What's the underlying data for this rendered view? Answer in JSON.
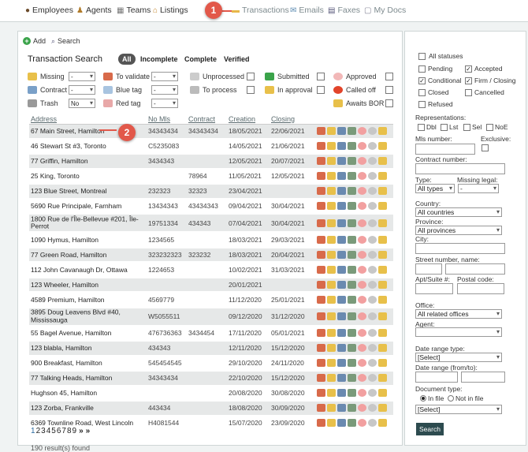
{
  "nav": {
    "items": [
      {
        "label": "Employees",
        "icon": "people-icon"
      },
      {
        "label": "Agents",
        "icon": "agent-icon"
      },
      {
        "label": "Teams",
        "icon": "teams-icon"
      },
      {
        "label": "Listings",
        "icon": "listings-icon"
      },
      {
        "label": "Transactions",
        "icon": "folder-icon"
      },
      {
        "label": "Emails",
        "icon": "email-icon"
      },
      {
        "label": "Faxes",
        "icon": "fax-icon"
      },
      {
        "label": "My Docs",
        "icon": "docs-icon"
      }
    ],
    "callout1": "1"
  },
  "toolbar": {
    "add_label": "Add",
    "search_label": "Search"
  },
  "main": {
    "title": "Transaction Search",
    "tabs": [
      "All",
      "Incomplete",
      "Complete",
      "Verified"
    ],
    "filters": {
      "missing": {
        "label": "Missing",
        "value": "-"
      },
      "to_validate": {
        "label": "To validate",
        "value": "-"
      },
      "unprocessed": {
        "label": "Unprocessed"
      },
      "submitted": {
        "label": "Submitted"
      },
      "approved": {
        "label": "Approved"
      },
      "contract": {
        "label": "Contract",
        "value": "-"
      },
      "blue_tag": {
        "label": "Blue tag",
        "value": "-"
      },
      "to_process": {
        "label": "To process"
      },
      "in_approval": {
        "label": "In approval"
      },
      "called_off": {
        "label": "Called off"
      },
      "trash": {
        "label": "Trash",
        "value": "No"
      },
      "red_tag": {
        "label": "Red tag",
        "value": "-"
      },
      "awaits_bor": {
        "label": "Awaits BOR"
      }
    },
    "columns": [
      "Address",
      "No Mls",
      "Contract",
      "Creation",
      "Closing"
    ],
    "rows": [
      {
        "address": "67 Main Street, Hamilton",
        "mls": "34343434",
        "contract": "34343434",
        "creation": "18/05/2021",
        "closing": "22/06/2021"
      },
      {
        "address": "46 Stewart St #3, Toronto",
        "mls": "C5235083",
        "contract": "",
        "creation": "14/05/2021",
        "closing": "21/06/2021"
      },
      {
        "address": "77 Griffin, Hamilton",
        "mls": "3434343",
        "contract": "",
        "creation": "12/05/2021",
        "closing": "20/07/2021"
      },
      {
        "address": "25 King, Toronto",
        "mls": "",
        "contract": "78964",
        "creation": "11/05/2021",
        "closing": "12/05/2021"
      },
      {
        "address": "123 Blue Street, Montreal",
        "mls": "232323",
        "contract": "32323",
        "creation": "23/04/2021",
        "closing": ""
      },
      {
        "address": "5690 Rue Principale, Farnham",
        "mls": "13434343",
        "contract": "43434343",
        "creation": "09/04/2021",
        "closing": "30/04/2021"
      },
      {
        "address": "1800 Rue de l'Île-Bellevue #201, Île-Perrot",
        "mls": "19751334",
        "contract": "434343",
        "creation": "07/04/2021",
        "closing": "30/04/2021"
      },
      {
        "address": "1090 Hymus, Hamilton",
        "mls": "1234565",
        "contract": "",
        "creation": "18/03/2021",
        "closing": "29/03/2021"
      },
      {
        "address": "77 Green Road, Hamilton",
        "mls": "323232323",
        "contract": "323232",
        "creation": "18/03/2021",
        "closing": "20/04/2021"
      },
      {
        "address": "112 John Cavanaugh Dr, Ottawa",
        "mls": "1224653",
        "contract": "",
        "creation": "10/02/2021",
        "closing": "31/03/2021"
      },
      {
        "address": "123 Wheeler, Hamilton",
        "mls": "",
        "contract": "",
        "creation": "20/01/2021",
        "closing": ""
      },
      {
        "address": "4589 Premium, Hamilton",
        "mls": "4569779",
        "contract": "",
        "creation": "11/12/2020",
        "closing": "25/01/2021"
      },
      {
        "address": "3895 Doug Leavens Blvd #40, Mississauga",
        "mls": "W5055511",
        "contract": "",
        "creation": "09/12/2020",
        "closing": "31/12/2020"
      },
      {
        "address": "55 Bagel Avenue, Hamilton",
        "mls": "476736363",
        "contract": "3434454",
        "creation": "17/11/2020",
        "closing": "05/01/2021"
      },
      {
        "address": "123 blabla, Hamilton",
        "mls": "434343",
        "contract": "",
        "creation": "12/11/2020",
        "closing": "15/12/2020"
      },
      {
        "address": "900 Breakfast, Hamilton",
        "mls": "545454545",
        "contract": "",
        "creation": "29/10/2020",
        "closing": "24/11/2020"
      },
      {
        "address": "77 Talking Heads, Hamilton",
        "mls": "34343434",
        "contract": "",
        "creation": "22/10/2020",
        "closing": "15/12/2020"
      },
      {
        "address": "Hughson 45, Hamilton",
        "mls": "",
        "contract": "",
        "creation": "20/08/2020",
        "closing": "30/08/2020"
      },
      {
        "address": "123 Zorba, Frankville",
        "mls": "443434",
        "contract": "",
        "creation": "18/08/2020",
        "closing": "30/09/2020"
      },
      {
        "address": "6369 Townline Road, West Lincoln",
        "mls": "H4081544",
        "contract": "",
        "creation": "15/07/2020",
        "closing": "23/09/2020"
      }
    ],
    "callout2": "2",
    "pager": {
      "pages": [
        "1",
        "2",
        "3",
        "4",
        "5",
        "6",
        "7",
        "8",
        "9"
      ],
      "next": "»",
      "last": "»"
    },
    "result_count": "190 result(s) found"
  },
  "sidebar": {
    "all_statuses": "All statuses",
    "statuses": [
      {
        "label": "Pending",
        "checked": false
      },
      {
        "label": "Accepted",
        "checked": true
      },
      {
        "label": "Conditional",
        "checked": true
      },
      {
        "label": "Firm / Closing",
        "checked": true
      },
      {
        "label": "Closed",
        "checked": false
      },
      {
        "label": "Cancelled",
        "checked": false
      },
      {
        "label": "Refused",
        "checked": false
      }
    ],
    "representations_label": "Representations:",
    "representations": [
      "Dbl",
      "Lst",
      "Sel",
      "NoE"
    ],
    "mls_label": "Mls number:",
    "exclusive_label": "Exclusive:",
    "contract_label": "Contract number:",
    "type_label": "Type:",
    "type_value": "All types",
    "missing_legal_label": "Missing legal:",
    "missing_legal_value": "-",
    "country_label": "Country:",
    "country_value": "All countries",
    "province_label": "Province:",
    "province_value": "All provinces",
    "city_label": "City:",
    "street_label": "Street number, name:",
    "apt_label": "Apt/Suite #:",
    "postal_label": "Postal code:",
    "office_label": "Office:",
    "office_value": "All related offices",
    "agent_label": "Agent:",
    "agent_value": "",
    "date_type_label": "Date range type:",
    "date_type_value": "[Select]",
    "date_range_label": "Date range (from/to):",
    "doc_type_label": "Document type:",
    "in_file": "In file",
    "not_in_file": "Not in file",
    "doc_type_value": "[Select]",
    "search_button": "Search"
  }
}
